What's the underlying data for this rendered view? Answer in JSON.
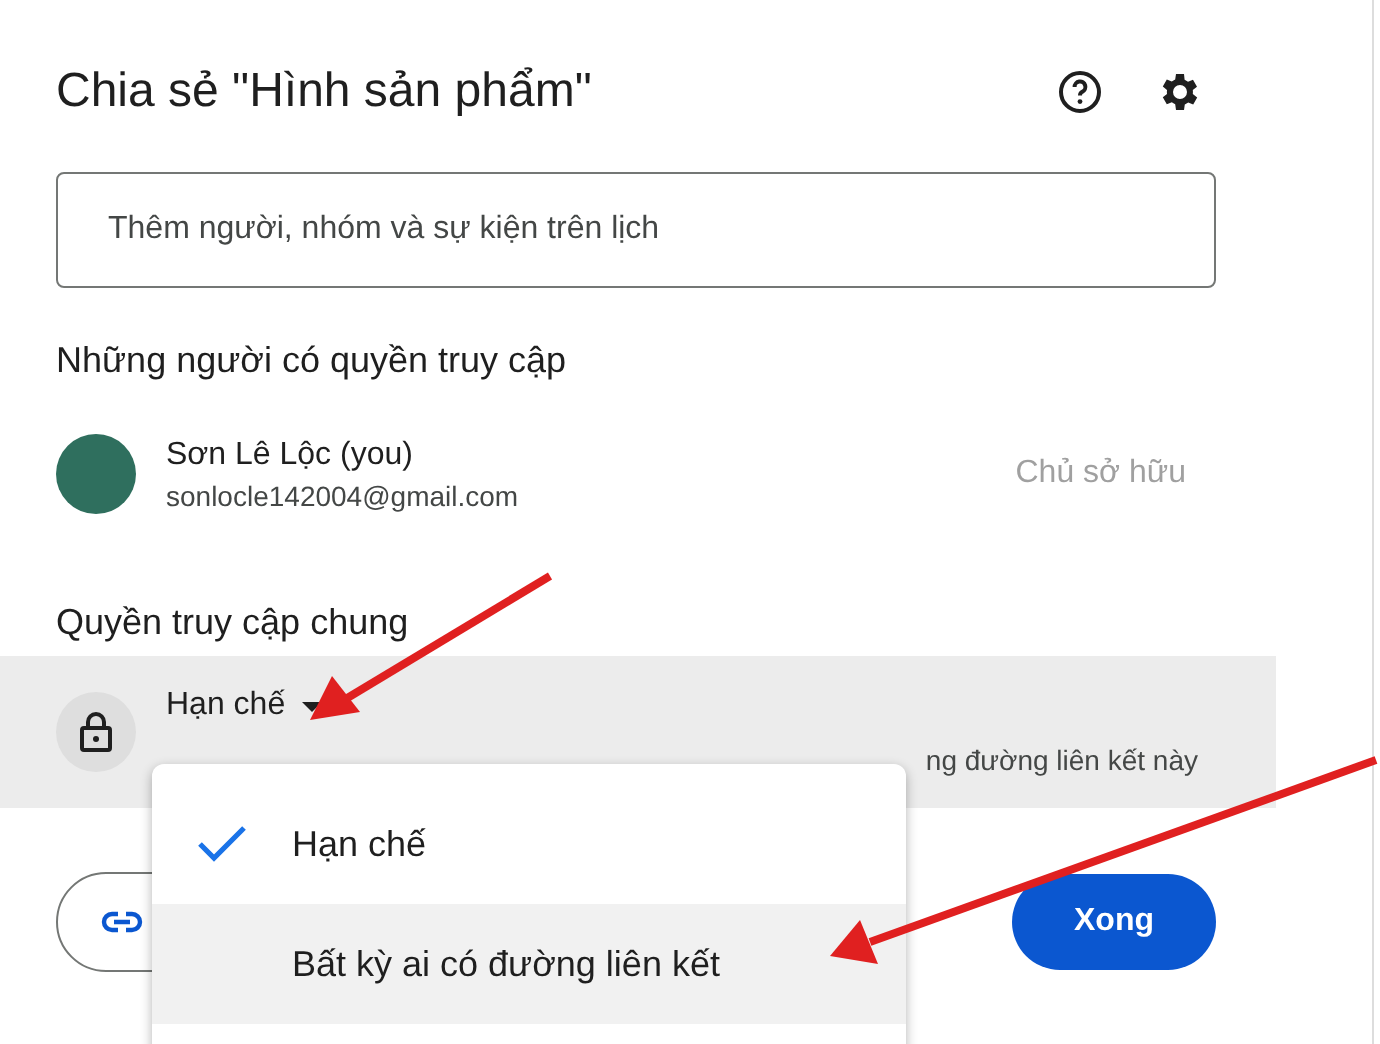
{
  "dialog": {
    "title": "Chia sẻ \"Hình sản phẩm\""
  },
  "add_people": {
    "placeholder": "Thêm người, nhóm và sự kiện trên lịch"
  },
  "people_section": {
    "heading": "Những người có quyền truy cập",
    "people": [
      {
        "name": "Sơn Lê Lộc (you)",
        "email": "sonlocle142004@gmail.com",
        "role": "Chủ sở hữu"
      }
    ]
  },
  "general_access": {
    "heading": "Quyền truy cập chung",
    "value": "Hạn chế",
    "description": "ng đường liên kết này"
  },
  "menu": [
    {
      "label": "Hạn chế",
      "selected": true,
      "highlighted": false
    },
    {
      "label": "Bất kỳ ai có đường liên kết",
      "selected": false,
      "highlighted": true
    }
  ],
  "done_button": "Xong"
}
